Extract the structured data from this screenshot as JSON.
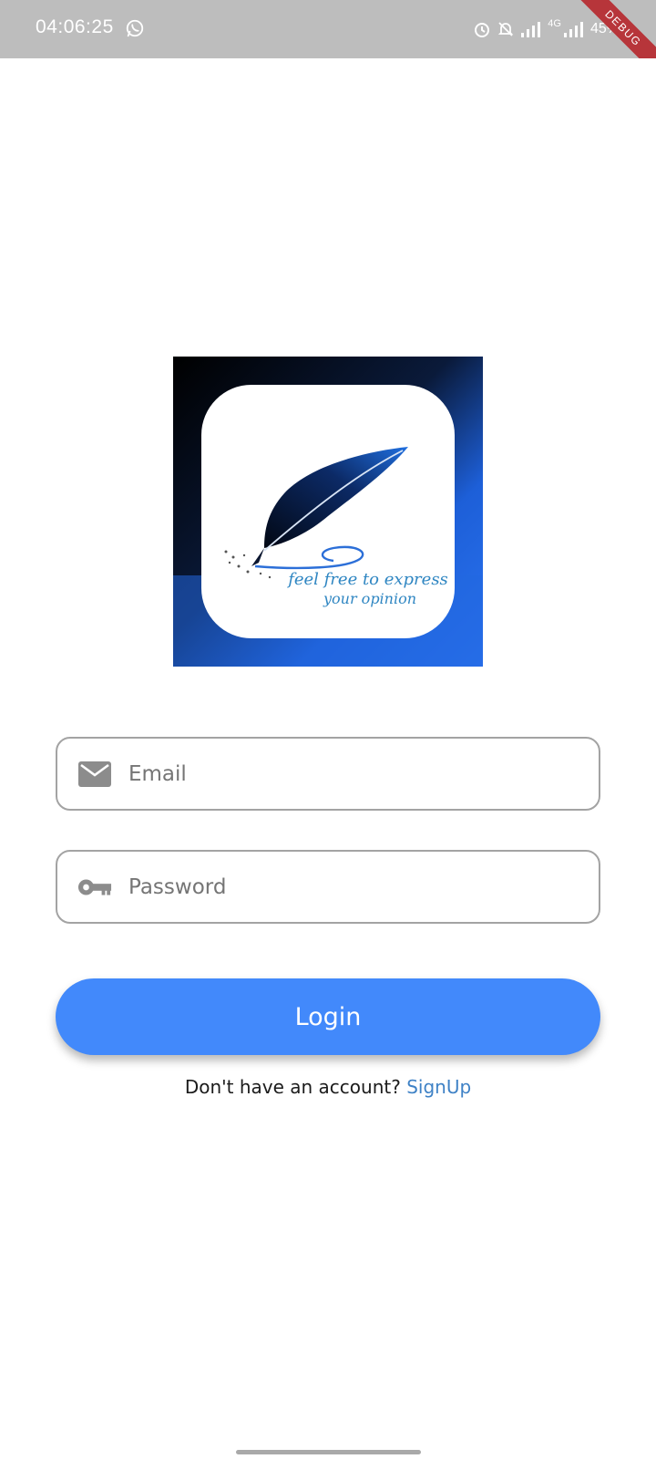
{
  "status_bar": {
    "time": "04:06:25",
    "net_type": "4G",
    "battery": "45%",
    "debug_banner": "DEBUG",
    "icons": [
      "whatsapp-icon",
      "alarm-icon",
      "mute-icon",
      "signal-icon",
      "network-signal-icon"
    ]
  },
  "logo": {
    "tagline_line1": "feel free to express",
    "tagline_line2": "your opinion"
  },
  "form": {
    "email": {
      "placeholder": "Email",
      "value": "",
      "icon": "envelope-icon"
    },
    "password": {
      "placeholder": "Password",
      "value": "",
      "icon": "key-icon"
    },
    "login_label": "Login",
    "signup_prompt": "Don't have an account?",
    "signup_link": "SignUp"
  },
  "colors": {
    "accent": "#4289fb",
    "link": "#3f82c6",
    "status_bar": "#bdbdbd",
    "field_border": "#a3a3a3",
    "icon_gray": "#8c8c8c",
    "debug_ribbon": "#b7353a"
  }
}
